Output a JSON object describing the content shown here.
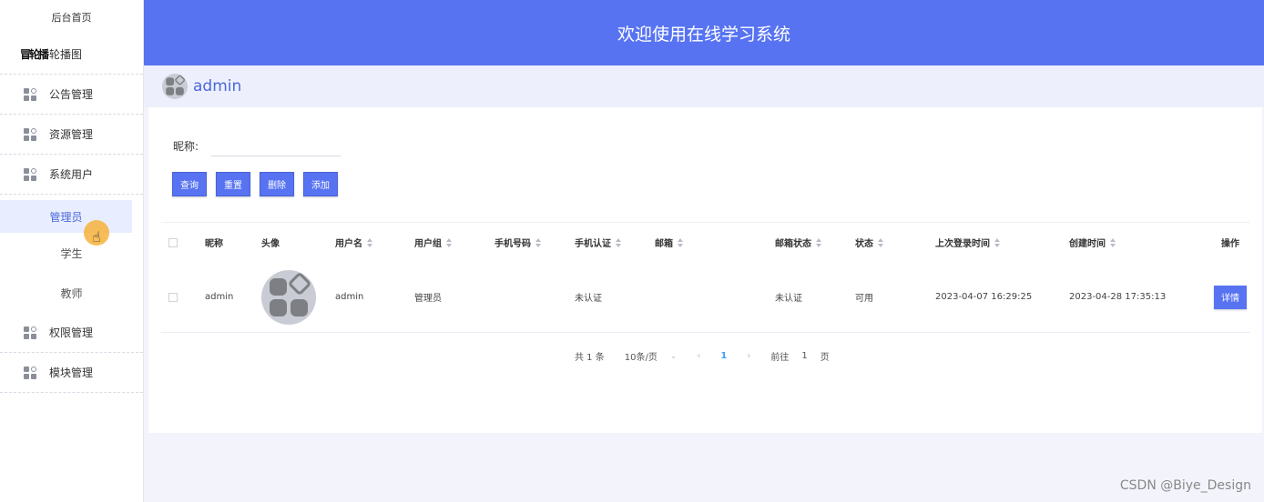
{
  "header": {
    "title": "欢迎使用在线学习系统"
  },
  "user": {
    "name": "admin"
  },
  "sidebar": {
    "home": "后台首页",
    "carousel": "轮播图",
    "carousel_overlay": "冒轮播",
    "items": [
      {
        "label": "公告管理",
        "icon": "grid-icon"
      },
      {
        "label": "资源管理",
        "icon": "grid-icon"
      },
      {
        "label": "系统用户",
        "icon": "grid-icon"
      }
    ],
    "sub_items": [
      {
        "label": "管理员",
        "active": true
      },
      {
        "label": "学生",
        "active": false
      },
      {
        "label": "教师",
        "active": false
      }
    ],
    "items_after": [
      {
        "label": "权限管理",
        "icon": "grid-icon"
      },
      {
        "label": "模块管理",
        "icon": "grid-icon"
      }
    ]
  },
  "search": {
    "label": "昵称:",
    "value": "",
    "placeholder": ""
  },
  "toolbar": {
    "query": "查询",
    "reset": "重置",
    "delete": "删除",
    "add": "添加"
  },
  "table": {
    "columns": [
      "昵称",
      "头像",
      "用户名",
      "用户组",
      "手机号码",
      "手机认证",
      "邮箱",
      "邮箱状态",
      "状态",
      "上次登录时间",
      "创建时间",
      "操作"
    ],
    "rows": [
      {
        "nickname": "admin",
        "username": "admin",
        "group": "管理员",
        "phone": "",
        "phone_verify": "未认证",
        "email": "",
        "email_status": "未认证",
        "status": "可用",
        "last_login": "2023-04-07 16:29:25",
        "created": "2023-04-28 17:35:13",
        "action": "详情"
      }
    ]
  },
  "pagination": {
    "total": "共 1 条",
    "page_size": "10条/页",
    "current": "1",
    "goto_label": "前往",
    "goto_value": "1",
    "page_unit": "页"
  },
  "watermark": "CSDN @Biye_Design",
  "colors": {
    "primary": "#5773f2",
    "active_link": "#409eff"
  }
}
